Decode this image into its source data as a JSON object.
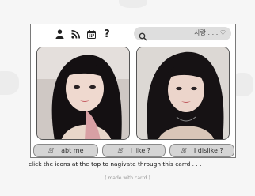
{
  "toolbar": {
    "icons": [
      "user-icon",
      "rss-icon",
      "calendar-icon",
      "help-icon"
    ],
    "help_glyph": "?"
  },
  "search": {
    "text": "사랑 . . . ♡"
  },
  "photos": [
    {
      "name": "portrait-photo-1"
    },
    {
      "name": "portrait-photo-2"
    }
  ],
  "buttons": [
    {
      "glyph": "ꕤ",
      "label": "abt me"
    },
    {
      "glyph": "ꕤ",
      "label": "I like ?"
    },
    {
      "glyph": "ꕤ",
      "label": "I dislike ?"
    }
  ],
  "caption": "click the icons at the top to nagivate through this carrd . . .",
  "credit": "( made with carrd )",
  "colors": {
    "page_background": "#f6f6f6",
    "card_background": "#ffffff",
    "border": "#7a7a7a",
    "search_fill": "#dedede",
    "button_fill": "#d5d5d5"
  }
}
